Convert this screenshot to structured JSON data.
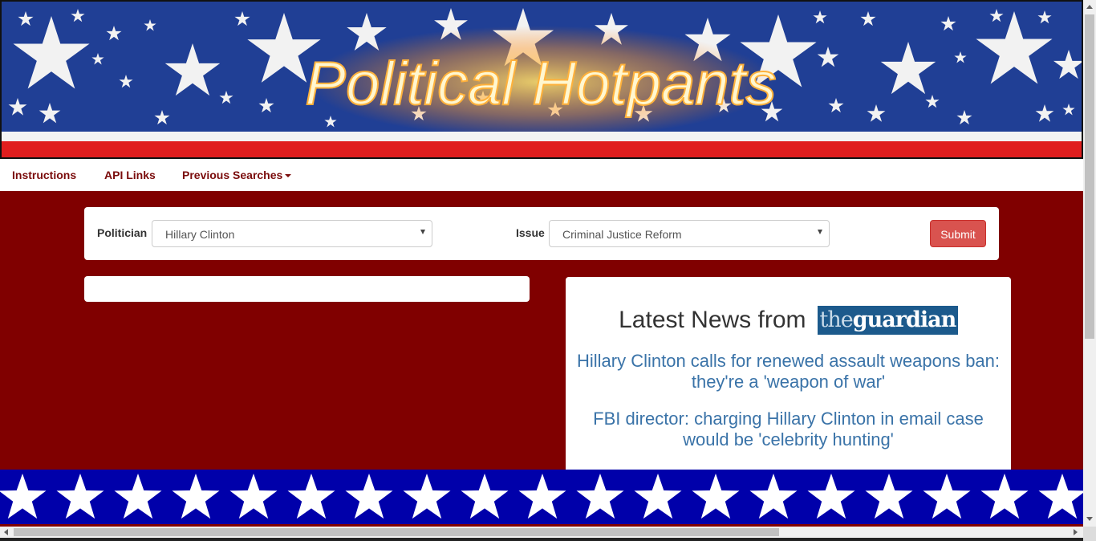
{
  "banner": {
    "title": "Political Hotpants"
  },
  "nav": {
    "instructions": "Instructions",
    "api_links": "API Links",
    "previous_searches": "Previous Searches"
  },
  "search": {
    "politician_label": "Politician",
    "politician_value": "Hillary Clinton",
    "issue_label": "Issue",
    "issue_value": "Criminal Justice Reform",
    "submit_label": "Submit"
  },
  "news": {
    "heading": "Latest News from",
    "source_logo_the": "the",
    "source_logo_name": "guardian",
    "articles": [
      "Hillary Clinton calls for renewed assault weapons ban: they're a 'weapon of war'",
      "FBI director: charging Hillary Clinton in email case would be 'celebrity hunting'"
    ]
  },
  "colors": {
    "page_background": "#800000",
    "nav_text": "#7a0b0b",
    "submit_button": "#d9534f",
    "link": "#3a73a8",
    "star_footer": "#0000aa"
  }
}
